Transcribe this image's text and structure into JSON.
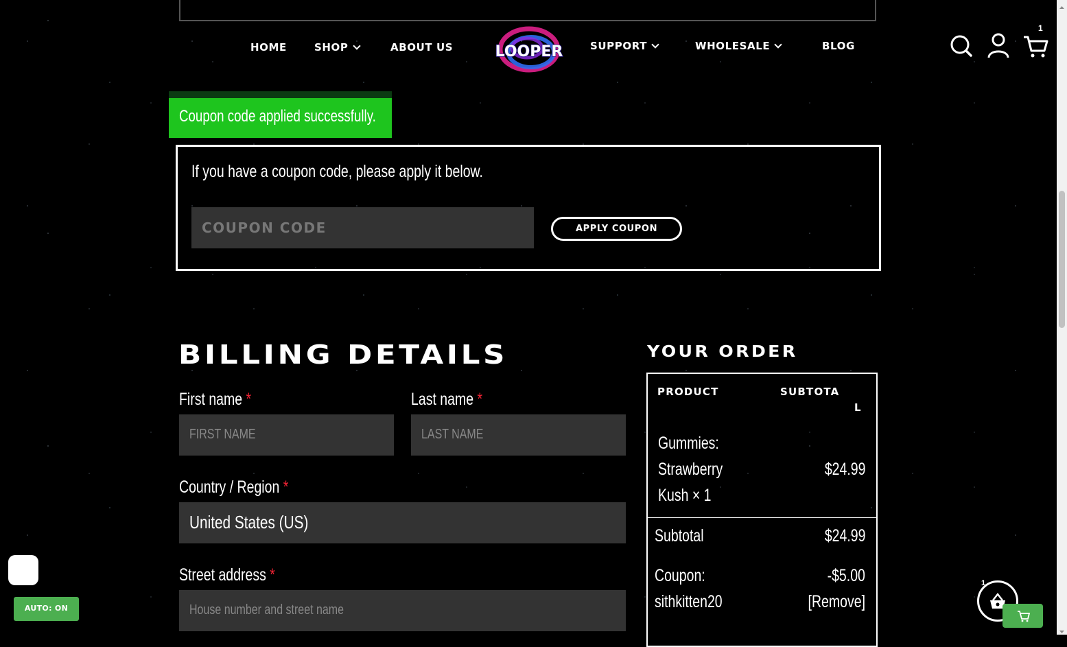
{
  "nav": {
    "left": [
      {
        "label": "HOME",
        "dropdown": false
      },
      {
        "label": "SHOP",
        "dropdown": true
      },
      {
        "label": "ABOUT US",
        "dropdown": false
      }
    ],
    "right": [
      {
        "label": "SUPPORT",
        "dropdown": true
      },
      {
        "label": "WHOLESALE",
        "dropdown": true
      },
      {
        "label": "BLOG",
        "dropdown": false
      }
    ],
    "logo_text": "LOOPER",
    "cart_count": "1"
  },
  "notice": {
    "text": "Coupon code applied successfully.",
    "color": "#1ec51e"
  },
  "coupon": {
    "intro": "If you have a coupon code, please apply it below.",
    "placeholder": "COUPON CODE",
    "button": "APPLY COUPON"
  },
  "billing": {
    "title": "BILLING DETAILS",
    "first_name": {
      "label": "First name",
      "required": "*",
      "placeholder": "FIRST NAME"
    },
    "last_name": {
      "label": "Last name",
      "required": "*",
      "placeholder": "LAST NAME"
    },
    "country": {
      "label": "Country / Region",
      "required": "*",
      "value": "United States (US)"
    },
    "street": {
      "label": "Street address",
      "required": "*",
      "placeholder": "House number and street name"
    }
  },
  "order": {
    "title": "YOUR ORDER",
    "col_product": "PRODUCT",
    "col_subtotal_a": "SUBTOTA",
    "col_subtotal_b": "L",
    "item_line1": "Gummies:",
    "item_line2": "Strawberry",
    "item_line3": "Kush",
    "item_qty": "× 1",
    "item_price": "$24.99",
    "subtotal_label": "Subtotal",
    "subtotal_value": "$24.99",
    "coupon_label": "Coupon:",
    "coupon_code": "sithkitten20",
    "coupon_value": "-$5.00",
    "coupon_remove": "[Remove]"
  },
  "widgets": {
    "auto_label": "AUTO: ON",
    "basket_count": "1",
    "accent": "#4caf50"
  }
}
